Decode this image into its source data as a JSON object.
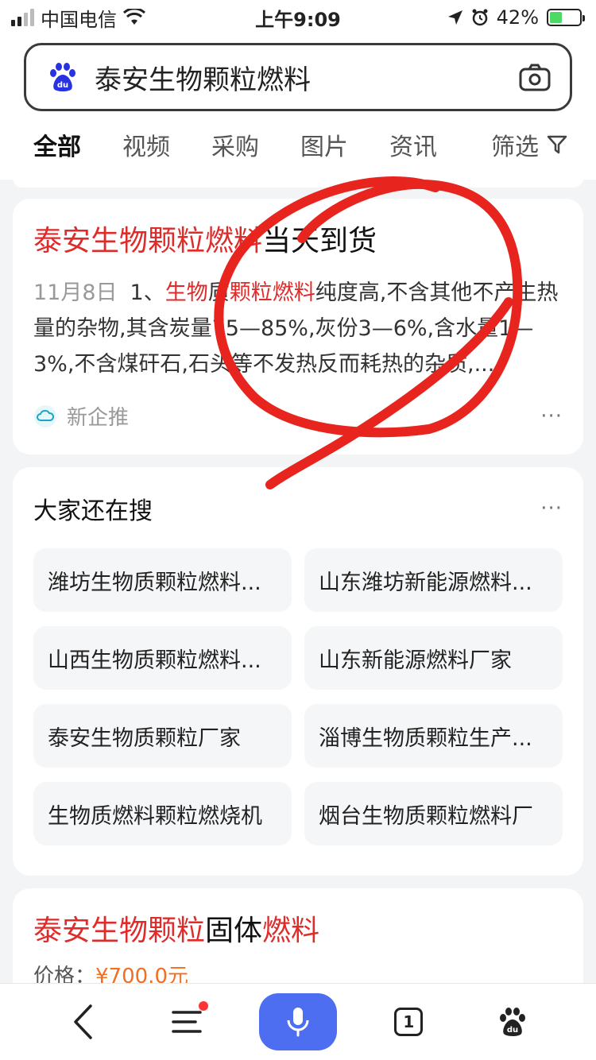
{
  "status": {
    "carrier": "中国电信",
    "time": "上午9:09",
    "battery": "42%",
    "battery_level": 0.42
  },
  "search": {
    "query": "泰安生物颗粒燃料"
  },
  "tabs": [
    {
      "label": "全部",
      "active": true
    },
    {
      "label": "视频"
    },
    {
      "label": "采购"
    },
    {
      "label": "图片"
    },
    {
      "label": "资讯"
    }
  ],
  "filter_label": "筛选",
  "result1": {
    "title_highlight": "泰安生物颗粒燃料",
    "title_rest": "当天到货",
    "date": "11月8日",
    "snippet_prefix": "1、",
    "snippet_hl1": "生物",
    "snippet_mid1": "质",
    "snippet_hl2": "颗粒燃料",
    "snippet_rest": "纯度高,不含其他不产生热量的杂物,其含炭量75—85%,灰份3—6%,含水量1—3%,不含煤矸石,石头等不发热反而耗热的杂质,...",
    "source": "新企推",
    "more": "···"
  },
  "related": {
    "title": "大家还在搜",
    "more": "···",
    "items": [
      "潍坊生物质颗粒燃料...",
      "山东潍坊新能源燃料...",
      "山西生物质颗粒燃料...",
      "山东新能源燃料厂家",
      "泰安生物质颗粒厂家",
      "淄博生物质颗粒生产...",
      "生物质燃料颗粒燃烧机",
      "烟台生物质颗粒燃料厂"
    ]
  },
  "result2": {
    "title_hl1": "泰安生物颗粒",
    "title_mid": "固体",
    "title_hl2": "燃料",
    "price_label": "价格：",
    "price_value": "¥700.0元"
  },
  "bottom": {
    "tab_count": "1"
  },
  "colors": {
    "accent": "#4e6ef2",
    "highlight_red": "#e02b2b",
    "annotation_red": "#e8241f"
  }
}
